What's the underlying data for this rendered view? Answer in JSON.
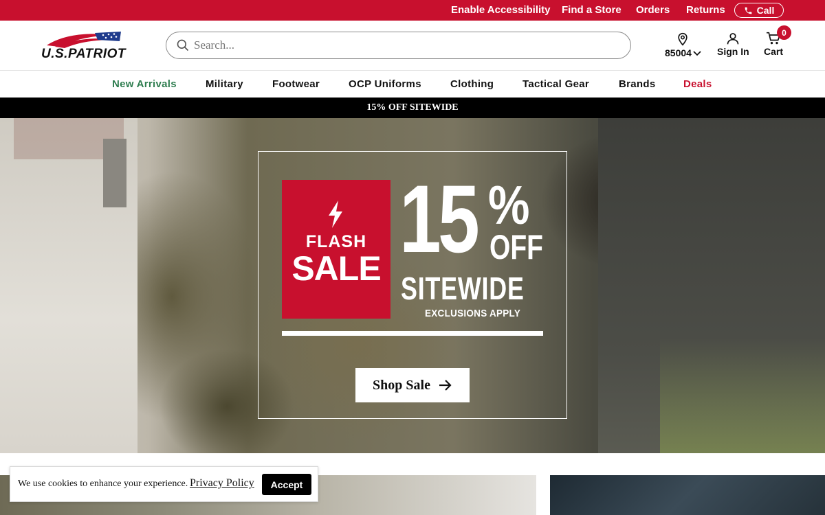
{
  "utility_bar": {
    "links": [
      "Enable Accessibility",
      "Find a Store",
      "Orders",
      "Returns"
    ],
    "call_label": "Call"
  },
  "header": {
    "logo_text": "U.S.PATRIOT",
    "search_placeholder": "Search...",
    "location_zip": "85004",
    "sign_in_label": "Sign In",
    "cart_label": "Cart",
    "cart_count": "0"
  },
  "nav": {
    "items": [
      "New Arrivals",
      "Military",
      "Footwear",
      "OCP Uniforms",
      "Clothing",
      "Tactical Gear",
      "Brands",
      "Deals"
    ]
  },
  "promo_bar": {
    "text": "15% OFF SITEWIDE"
  },
  "hero": {
    "flash_line1": "FLASH",
    "flash_line2": "SALE",
    "discount_number": "15",
    "discount_percent": "%",
    "discount_off": "OFF",
    "sitewide": "SITEWIDE",
    "exclusions": "EXCLUSIONS APPLY",
    "cta_label": "Shop Sale"
  },
  "cookie_banner": {
    "message": "We use cookies to enhance your experience.",
    "policy_link": "Privacy Policy",
    "accept_label": "Accept"
  },
  "colors": {
    "brand_red": "#c8102e",
    "nav_new_arrivals": "#2e7d4f",
    "nav_deals": "#c8102e"
  }
}
